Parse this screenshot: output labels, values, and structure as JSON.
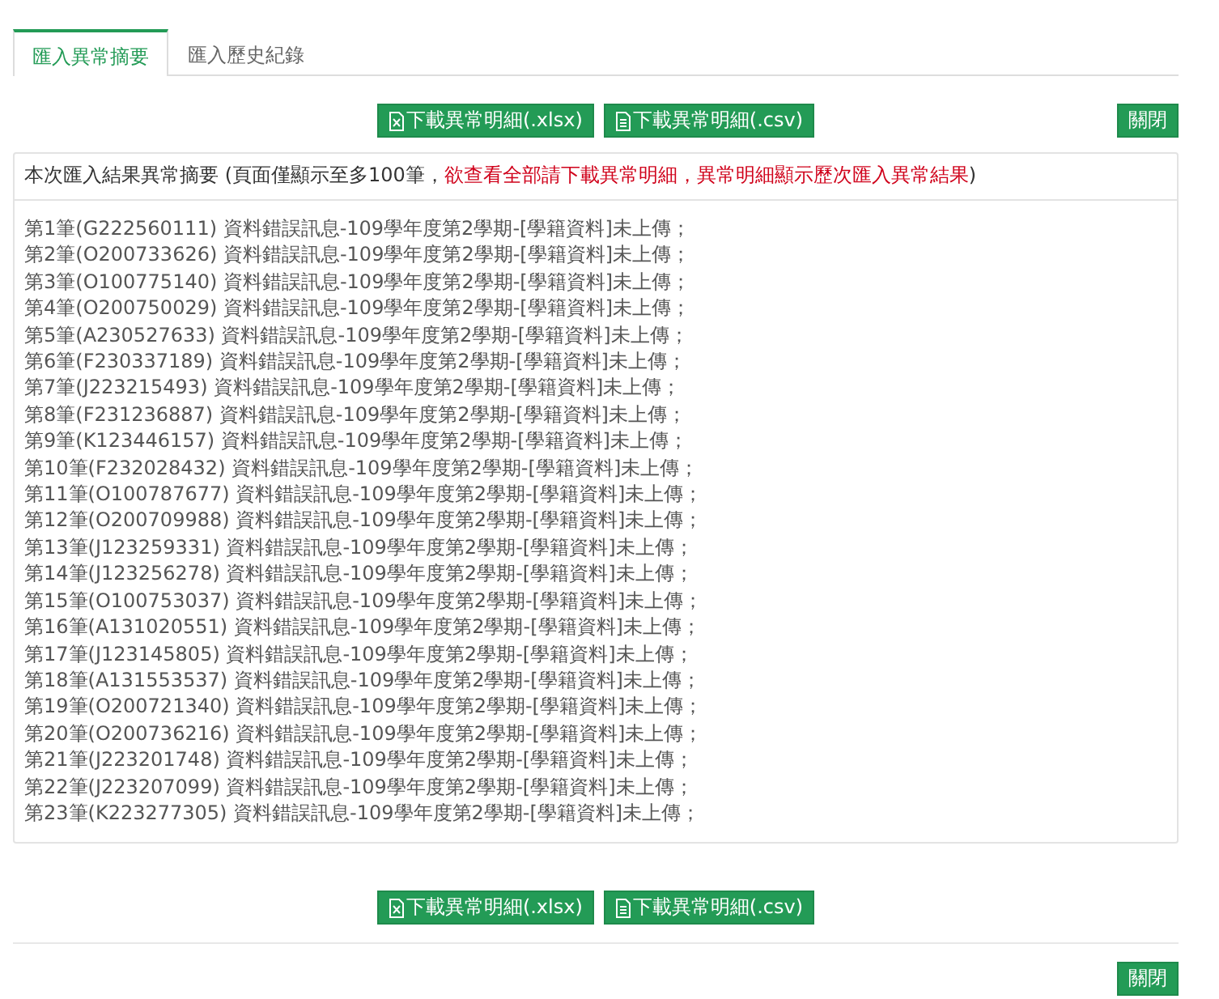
{
  "tabs": [
    {
      "label": "匯入異常摘要",
      "selected": true
    },
    {
      "label": "匯入歷史紀錄",
      "selected": false
    }
  ],
  "top_toolbar": {
    "downloads": [
      {
        "kind": "xlsx",
        "label": "下載異常明細(.xlsx)"
      },
      {
        "kind": "csv",
        "label": "下載異常明細(.csv)"
      }
    ],
    "close": "關閉"
  },
  "summary": {
    "text": "本次匯入結果異常摘要 (頁面僅顯示至多100筆，",
    "warning": "欲查看全部請下載異常明細，異常明細顯示歷次匯入異常結果",
    "closing": ")"
  },
  "errors": [
    "第1筆(G222560111) 資料錯誤訊息-109學年度第2學期-[學籍資料]未上傳；",
    "第2筆(O200733626) 資料錯誤訊息-109學年度第2學期-[學籍資料]未上傳；",
    "第3筆(O100775140) 資料錯誤訊息-109學年度第2學期-[學籍資料]未上傳；",
    "第4筆(O200750029) 資料錯誤訊息-109學年度第2學期-[學籍資料]未上傳；",
    "第5筆(A230527633) 資料錯誤訊息-109學年度第2學期-[學籍資料]未上傳；",
    "第6筆(F230337189) 資料錯誤訊息-109學年度第2學期-[學籍資料]未上傳；",
    "第7筆(J223215493) 資料錯誤訊息-109學年度第2學期-[學籍資料]未上傳；",
    "第8筆(F231236887) 資料錯誤訊息-109學年度第2學期-[學籍資料]未上傳；",
    "第9筆(K123446157) 資料錯誤訊息-109學年度第2學期-[學籍資料]未上傳；",
    "第10筆(F232028432) 資料錯誤訊息-109學年度第2學期-[學籍資料]未上傳；",
    "第11筆(O100787677) 資料錯誤訊息-109學年度第2學期-[學籍資料]未上傳；",
    "第12筆(O200709988) 資料錯誤訊息-109學年度第2學期-[學籍資料]未上傳；",
    "第13筆(J123259331) 資料錯誤訊息-109學年度第2學期-[學籍資料]未上傳；",
    "第14筆(J123256278) 資料錯誤訊息-109學年度第2學期-[學籍資料]未上傳；",
    "第15筆(O100753037) 資料錯誤訊息-109學年度第2學期-[學籍資料]未上傳；",
    "第16筆(A131020551) 資料錯誤訊息-109學年度第2學期-[學籍資料]未上傳；",
    "第17筆(J123145805) 資料錯誤訊息-109學年度第2學期-[學籍資料]未上傳；",
    "第18筆(A131553537) 資料錯誤訊息-109學年度第2學期-[學籍資料]未上傳；",
    "第19筆(O200721340) 資料錯誤訊息-109學年度第2學期-[學籍資料]未上傳；",
    "第20筆(O200736216) 資料錯誤訊息-109學年度第2學期-[學籍資料]未上傳；",
    "第21筆(J223201748) 資料錯誤訊息-109學年度第2學期-[學籍資料]未上傳；",
    "第22筆(J223207099) 資料錯誤訊息-109學年度第2學期-[學籍資料]未上傳；",
    "第23筆(K223277305) 資料錯誤訊息-109學年度第2學期-[學籍資料]未上傳；"
  ],
  "bottom_toolbar": {
    "downloads": [
      {
        "kind": "xlsx",
        "label": "下載異常明細(.xlsx)"
      },
      {
        "kind": "csv",
        "label": "下載異常明細(.csv)"
      }
    ]
  },
  "footer": {
    "close": "關閉"
  }
}
